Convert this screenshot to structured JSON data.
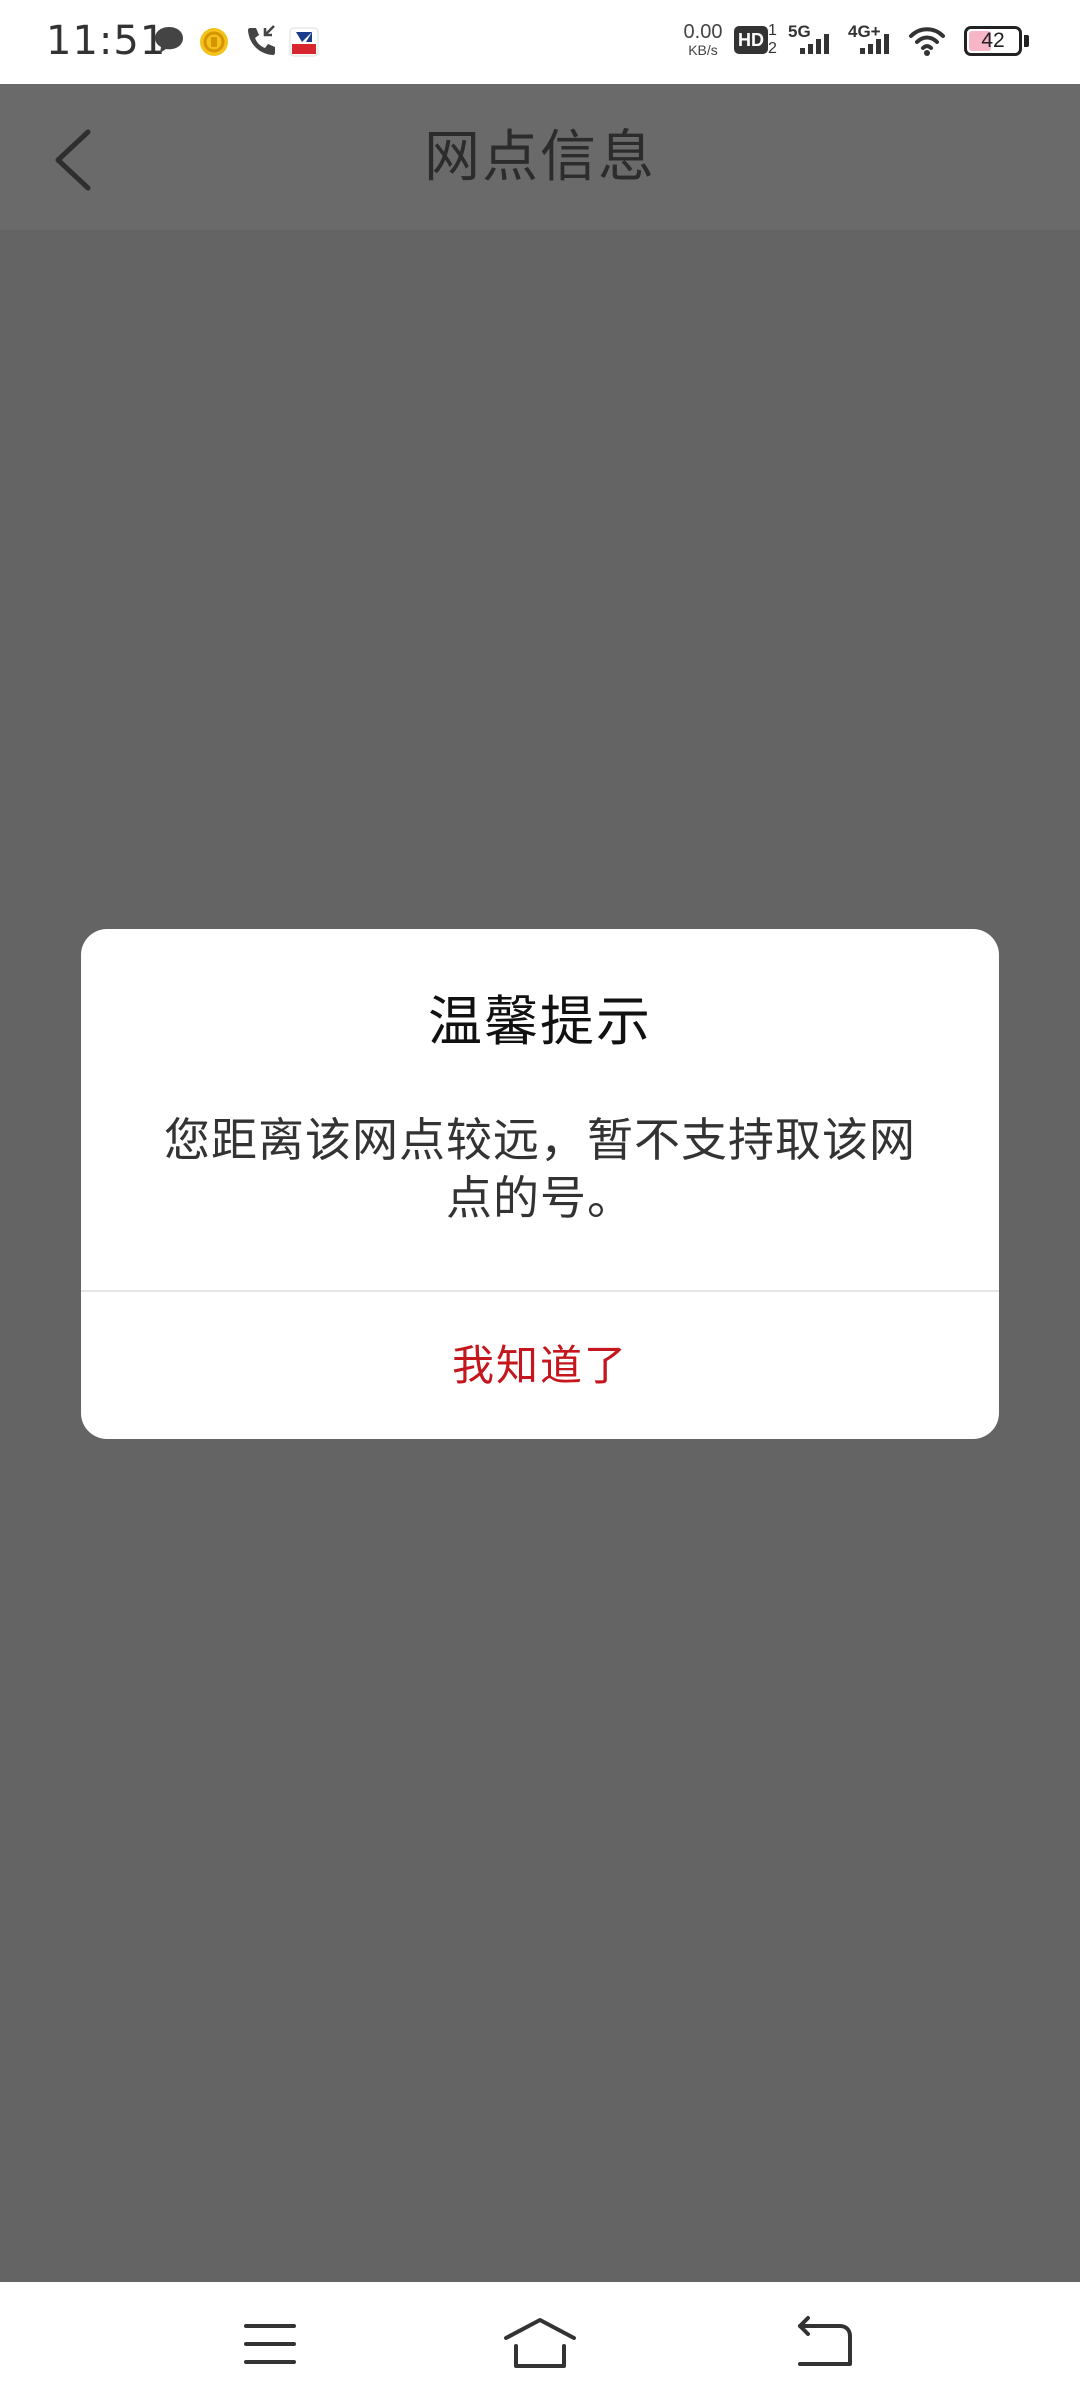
{
  "status_bar": {
    "time": "11:51",
    "net_speed_value": "0.00",
    "net_speed_unit": "KB/s",
    "hd_label": "HD",
    "sim1_label": "5G",
    "sim2_label": "4G+",
    "battery_level": "42",
    "icons": [
      "message-icon",
      "coin-app-icon",
      "call-icon",
      "bank-app-icon",
      "hd-icon",
      "signal-5g-icon",
      "signal-4g-icon",
      "wifi-icon",
      "battery-icon"
    ]
  },
  "header": {
    "title": "网点信息",
    "back_icon": "chevron-left-icon"
  },
  "dialog": {
    "title": "温馨提示",
    "message": "您距离该网点较远，暂不支持取该网点的号。",
    "confirm_label": "我知道了"
  },
  "nav_bar": {
    "icons": [
      "menu-icon",
      "home-icon",
      "back-icon"
    ]
  },
  "colors": {
    "overlay": "#646464",
    "accent_red": "#c4161c",
    "dialog_bg": "#ffffff"
  }
}
